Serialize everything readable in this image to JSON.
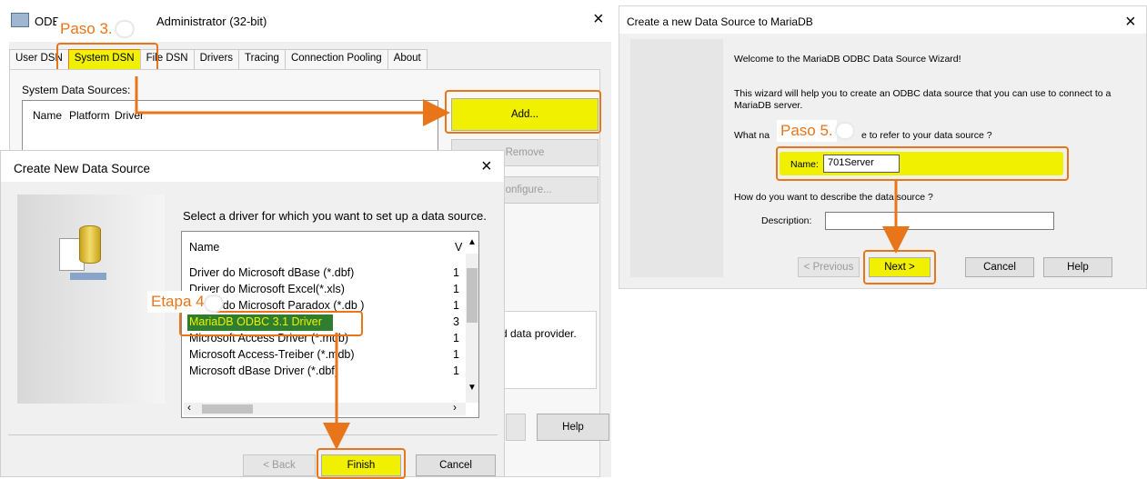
{
  "odbc_admin": {
    "title_prefix": "ODB",
    "title_suffix": "Administrator (32-bit)",
    "close": "×",
    "tabs": [
      "User DSN",
      "System DSN",
      "File DSN",
      "Drivers",
      "Tracing",
      "Connection Pooling",
      "About"
    ],
    "system_sources_label": "System Data Sources:",
    "columns": [
      "Name",
      "Platform",
      "Driver"
    ],
    "buttons": {
      "add": "Add...",
      "remove": "Remove",
      "configure": "Configure...",
      "help": "Help"
    },
    "provider_text": "d data provider."
  },
  "create_new": {
    "title": "Create New Data Source",
    "close": "×",
    "instruction": "Select a driver for which you want to set up a data source.",
    "list_header": "Name",
    "list_header_v": "V",
    "drivers": [
      {
        "name": "Driver do Microsoft dBase (*.dbf)",
        "v": "1"
      },
      {
        "name": "Driver do Microsoft Excel(*.xls)",
        "v": "1"
      },
      {
        "name": "Driver do Microsoft Paradox (*.db )",
        "v": "1"
      },
      {
        "name": "MariaDB ODBC 3.1 Driver",
        "v": "3"
      },
      {
        "name": "Microsoft Access Driver (*.mdb)",
        "v": "1"
      },
      {
        "name": "Microsoft Access-Treiber (*.mdb)",
        "v": "1"
      },
      {
        "name": "Microsoft dBase Driver (*.dbf)",
        "v": "1"
      }
    ],
    "buttons": {
      "back": "< Back",
      "finish": "Finish",
      "cancel": "Cancel"
    }
  },
  "mariadb_wizard": {
    "title": "Create a new Data Source to MariaDB",
    "close": "×",
    "welcome": "Welcome to the MariaDB ODBC Data Source Wizard!",
    "intro": "This wizard will help you to create an ODBC data source that you can use to connect to a MariaDB server.",
    "name_question_start": "What na",
    "name_question_end": "e to refer to your data source ?",
    "name_label": "Name:",
    "name_value": "701Server",
    "describe_question": "How do you want to describe the data source ?",
    "description_label": "Description:",
    "description_value": "",
    "buttons": {
      "previous": "< Previous",
      "next": "Next >",
      "cancel": "Cancel",
      "help": "Help"
    }
  },
  "callouts": {
    "step3": "Paso 3.",
    "step4": "Etapa 4.",
    "step5": "Paso 5."
  },
  "colors": {
    "highlight": "#e8751a",
    "yellow": "#f0f000",
    "arrow": "#e8751a"
  }
}
